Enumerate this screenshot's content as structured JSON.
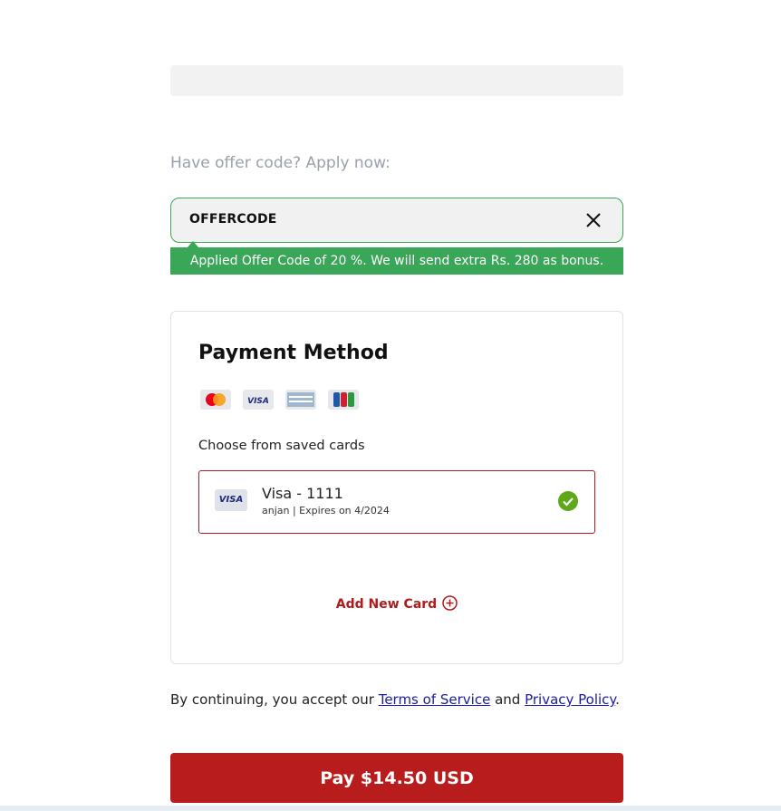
{
  "offer": {
    "prompt": "Have offer code? Apply now:",
    "code_value": "OFFERCODE",
    "applied_message": "Applied Offer Code of 20 %. We will send extra Rs. 280 as bonus.",
    "success_color": "#3aa657"
  },
  "payment": {
    "title": "Payment Method",
    "brands": [
      {
        "name": "Mastercard",
        "icon": "mastercard-icon"
      },
      {
        "name": "Visa",
        "icon": "visa-icon"
      },
      {
        "name": "American Express",
        "icon": "amex-icon"
      },
      {
        "name": "JCB",
        "icon": "jcb-icon"
      }
    ],
    "saved_label": "Choose from saved cards",
    "saved_card": {
      "brand_badge": "VISA",
      "name": "Visa - 1111",
      "details": "anjan | Expires on 4/2024",
      "selected": true
    },
    "add_new_card": "Add New Card",
    "accent_color": "#b01c1c"
  },
  "terms": {
    "prefix": "By continuing, you accept our ",
    "terms_link": "Terms of Service",
    "and_text": " and ",
    "privacy_link": "Privacy Policy",
    "suffix": "."
  },
  "pay_button": {
    "label": "Pay $14.50 USD",
    "color": "#b81c1c"
  }
}
